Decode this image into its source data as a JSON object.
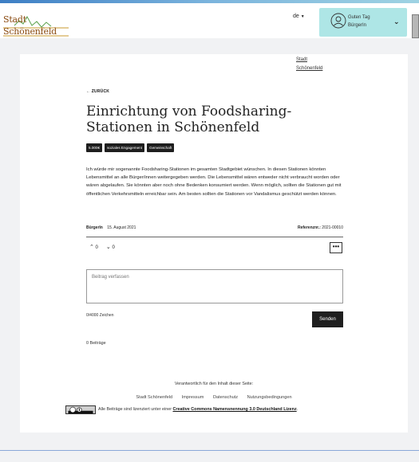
{
  "header": {
    "logo_line1": "Stadt",
    "logo_line2": "Schönenfeld",
    "language": "de",
    "greeting": "Guten Tag",
    "username": "BürgerIn"
  },
  "breadcrumb": {
    "line1": "Stadt",
    "line2": "Schönenfeld"
  },
  "back_label": "← ZURÜCK",
  "title": "Einrichtung von Foodsharing-Stationen in Schönenfeld",
  "tags": [
    "5.000€",
    "soziales Engagement",
    "Gemeinschaft"
  ],
  "description": "Ich würde mir sogenannte Foodsharing-Stationen im gesamten Stadtgebiet wünschen. In diesen Stationen könnten Lebensmittel an alle Bürger/innen weitergegeben werden. Die Lebensmittel wären entweder nicht verbraucht worden oder wären abgelaufen. Sie könnten aber noch ohne Bedenken konsumiert werden. Wenn möglich, sollten die Stationen gut mit öffentlichen Verkehrsmitteln erreichbar sein. Am besten sollten die Stationen vor Vandalismus geschützt werden können.",
  "meta": {
    "author": "BürgerIn",
    "date": "15. August 2021",
    "ref_label": "Referenznr.:",
    "ref_value": "2021-00010"
  },
  "votes": {
    "up": "0",
    "down": "0"
  },
  "more_label": "•••",
  "comment": {
    "placeholder": "Beitrag verfassen",
    "counter": "0/4000 Zeichen",
    "send_label": "Senden",
    "posts_count": "0 Beiträge"
  },
  "footer": {
    "responsible": "Verantwortlich für den Inhalt dieser Seite:",
    "links": [
      "Stadt Schönenfeld",
      "Impressum",
      "Datenschutz",
      "Nutzungsbedingungen"
    ],
    "license_prefix": "Alle Beiträge sind lizenziert unter einer",
    "license_link": "Creative Commons Namensnennung 3.0 Deutschland Lizenz",
    "license_suffix": "."
  },
  "colors": {
    "user_box": "#aee6e6",
    "tag_bg": "#1e1e1e",
    "button_bg": "#1f1f1f",
    "logo_text": "#8a4a10",
    "logo_graph": "#5aa04a"
  }
}
